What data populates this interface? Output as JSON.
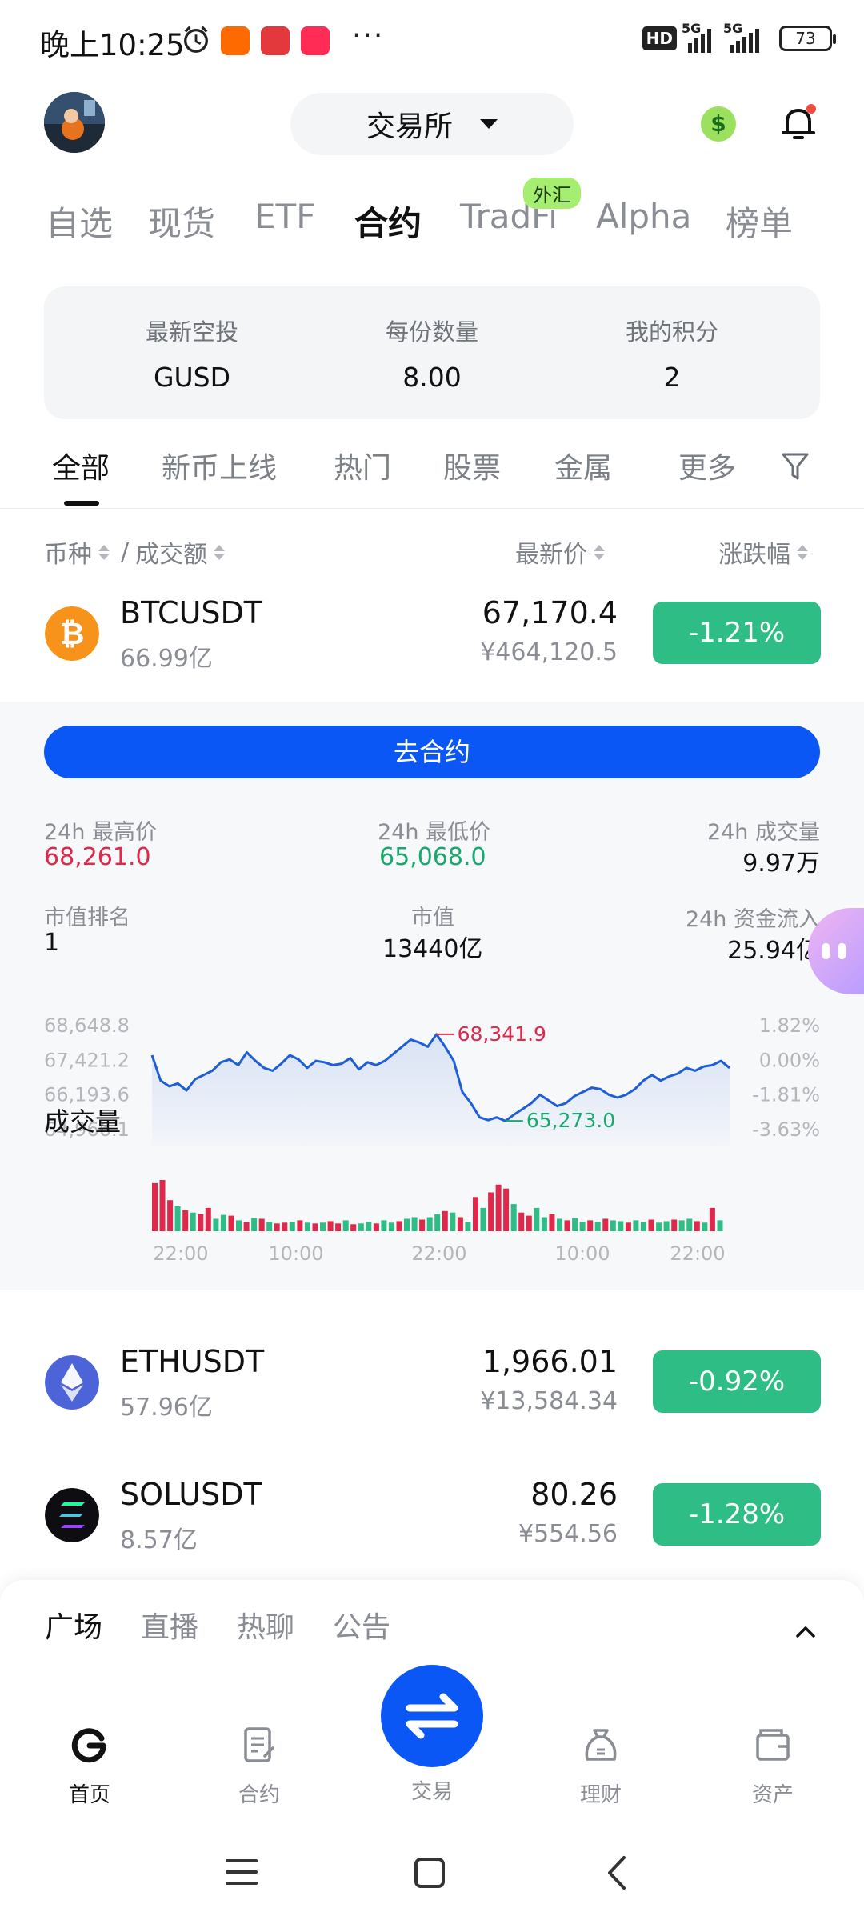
{
  "status_bar": {
    "time": "晚上10:25",
    "more": "···",
    "hd": "HD",
    "net1": "5G",
    "net2": "5G",
    "battery": "73"
  },
  "header": {
    "exchange_label": "交易所",
    "dollar_symbol": "$"
  },
  "top_tabs": [
    {
      "label": "自选"
    },
    {
      "label": "现货"
    },
    {
      "label": "ETF"
    },
    {
      "label": "合约"
    },
    {
      "label": "TradFi"
    },
    {
      "label": "Alpha"
    },
    {
      "label": "榜单"
    }
  ],
  "fx_badge": "外汇",
  "airdrop": {
    "col1_label": "最新空投",
    "col1_value": "GUSD",
    "col2_label": "每份数量",
    "col2_value": "8.00",
    "col3_label": "我的积分",
    "col3_value": "2"
  },
  "category_tabs": [
    {
      "label": "全部"
    },
    {
      "label": "新币上线"
    },
    {
      "label": "热门"
    },
    {
      "label": "股票"
    },
    {
      "label": "金属"
    },
    {
      "label": "更多"
    }
  ],
  "list_header": {
    "coin": "币种",
    "sep": "/",
    "turnover": "成交额",
    "price": "最新价",
    "change": "涨跌幅"
  },
  "coins": [
    {
      "name": "BTCUSDT",
      "volume": "66.99亿",
      "price": "67,170.4",
      "cny": "¥464,120.5",
      "change": "-1.21%"
    },
    {
      "name": "ETHUSDT",
      "volume": "57.96亿",
      "price": "1,966.01",
      "cny": "¥13,584.34",
      "change": "-0.92%"
    },
    {
      "name": "SOLUSDT",
      "volume": "8.57亿",
      "price": "80.26",
      "cny": "¥554.56",
      "change": "-1.28%"
    }
  ],
  "btc_panel": {
    "go_button": "去合约",
    "high_label": "24h 最高价",
    "high_value": "68,261.0",
    "low_label": "24h 最低价",
    "low_value": "65,068.0",
    "vol_label": "24h 成交量",
    "vol_value": "9.97万",
    "rank_label": "市值排名",
    "rank_value": "1",
    "mcap_label": "市值",
    "mcap_value": "13440亿",
    "inflow_label": "24h 资金流入",
    "inflow_value": "25.94亿",
    "volume_chart_label": "成交量"
  },
  "chart_data": {
    "type": "line",
    "title": "",
    "y_ticks_left": [
      "68,648.8",
      "67,421.2",
      "66,193.6",
      "64,966.1"
    ],
    "y_ticks_right": [
      "1.82%",
      "0.00%",
      "-1.81%",
      "-3.63%"
    ],
    "x_ticks": [
      "22:00",
      "10:00",
      "22:00",
      "10:00",
      "22:00"
    ],
    "ylim": [
      64966.1,
      68648.8
    ],
    "max_annotation": "68,341.9",
    "min_annotation": "65,273.0",
    "series": [
      {
        "values": [
          67600,
          66700,
          66500,
          66600,
          66350,
          66750,
          66900,
          67050,
          67350,
          67450,
          67250,
          67700,
          67400,
          67150,
          67050,
          67300,
          67600,
          67450,
          67150,
          67400,
          67350,
          67250,
          67300,
          67500,
          67100,
          67350,
          67250,
          67400,
          67650,
          67900,
          68150,
          68050,
          67900,
          68341.9,
          67900,
          67400,
          66300,
          65900,
          65400,
          65300,
          65400,
          65273,
          65500,
          65700,
          65900,
          66200,
          66000,
          65800,
          65900,
          66150,
          66300,
          66450,
          66400,
          66200,
          66100,
          66200,
          66400,
          66700,
          66900,
          66700,
          66850,
          66950,
          67150,
          67050,
          67200,
          67250,
          67400,
          67150
        ]
      }
    ],
    "volume": [
      62,
      66,
      40,
      32,
      27,
      24,
      22,
      30,
      16,
      21,
      20,
      14,
      12,
      17,
      16,
      12,
      10,
      11,
      12,
      14,
      11,
      10,
      11,
      13,
      10,
      14,
      9,
      10,
      12,
      10,
      14,
      11,
      13,
      16,
      18,
      15,
      18,
      22,
      26,
      24,
      18,
      12,
      44,
      30,
      50,
      60,
      55,
      35,
      24,
      20,
      30,
      18,
      22,
      16,
      14,
      17,
      12,
      14,
      12,
      16,
      14,
      13,
      11,
      14,
      12,
      15,
      11,
      13,
      15,
      14,
      16,
      13,
      11,
      30,
      14
    ],
    "volume_up": [
      false,
      false,
      false,
      true,
      false,
      true,
      false,
      false,
      true,
      true,
      false,
      true,
      false,
      true,
      false,
      true,
      false,
      false,
      true,
      false,
      true,
      false,
      true,
      false,
      false,
      true,
      false,
      true,
      true,
      false,
      true,
      true,
      false,
      true,
      true,
      false,
      true,
      true,
      false,
      true,
      false,
      true,
      false,
      true,
      false,
      false,
      false,
      true,
      false,
      false,
      true,
      true,
      false,
      true,
      false,
      true,
      true,
      false,
      true,
      false,
      true,
      true,
      false,
      true,
      true,
      false,
      true,
      true,
      false,
      true,
      true,
      false,
      true,
      false,
      true
    ]
  },
  "feed_tabs": [
    {
      "label": "广场"
    },
    {
      "label": "直播"
    },
    {
      "label": "热聊"
    },
    {
      "label": "公告"
    }
  ],
  "bottom_nav": [
    {
      "label": "首页"
    },
    {
      "label": "合约"
    },
    {
      "label": "交易"
    },
    {
      "label": "理财"
    },
    {
      "label": "资产"
    }
  ],
  "colors": {
    "accent": "#0b57f5",
    "down": "#2ebd85",
    "up": "#e0294a",
    "line": "#1f5fd6"
  }
}
